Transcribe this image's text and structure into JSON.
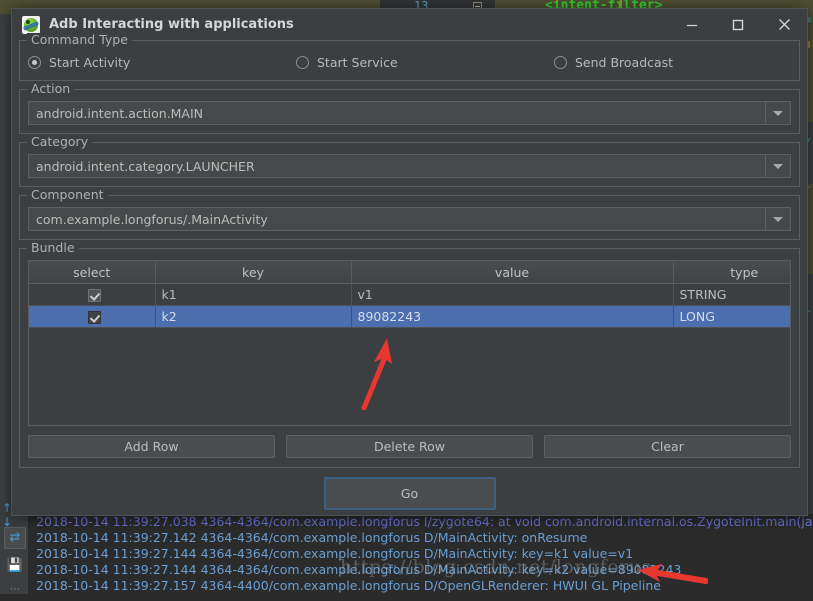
{
  "dialog": {
    "title": "Adb Interacting with applications",
    "icon": "android-adb-icon",
    "window_controls": {
      "minimize": "minimize-icon",
      "maximize": "maximize-icon",
      "close": "close-icon"
    },
    "command_type": {
      "legend": "Command Type",
      "options": [
        {
          "label": "Start Activity",
          "selected": true
        },
        {
          "label": "Start Service",
          "selected": false
        },
        {
          "label": "Send Broadcast",
          "selected": false
        }
      ]
    },
    "action": {
      "legend": "Action",
      "value": "android.intent.action.MAIN"
    },
    "category": {
      "legend": "Category",
      "value": "android.intent.category.LAUNCHER"
    },
    "component": {
      "legend": "Component",
      "value": "com.example.longforus/.MainActivity"
    },
    "bundle": {
      "legend": "Bundle",
      "columns": [
        "select",
        "key",
        "value",
        "type"
      ],
      "rows": [
        {
          "select": true,
          "key": "k1",
          "value": "v1",
          "type": "STRING",
          "selected": false
        },
        {
          "select": true,
          "key": "k2",
          "value": "89082243",
          "type": "LONG",
          "selected": true
        }
      ],
      "buttons": {
        "add": "Add Row",
        "delete": "Delete Row",
        "clear": "Clear"
      }
    },
    "go_button": "Go"
  },
  "ide_background": {
    "line_number": "13",
    "xml_snippet": "<intent-filter>"
  },
  "logcat": {
    "lines": [
      {
        "text": "2018-10-14 11:39:27.038 4364-4364/com.example.longforus I/zygote64:    at void com.android.internal.os.ZygoteInit.main(java.lang.S",
        "level": "info"
      },
      {
        "text": "2018-10-14 11:39:27.142 4364-4364/com.example.longforus D/MainActivity: onResume",
        "level": "debug"
      },
      {
        "text": "2018-10-14 11:39:27.144 4364-4364/com.example.longforus D/MainActivity: key=k1  value=v1",
        "level": "debug"
      },
      {
        "text": "2018-10-14 11:39:27.144 4364-4364/com.example.longforus D/MainActivity: key=k2  value=89082243",
        "level": "debug"
      },
      {
        "text": "2018-10-14 11:39:27.157 4364-4400/com.example.longforus D/OpenGLRenderer: HWUI GL Pipeline",
        "level": "debug"
      }
    ]
  },
  "watermark": "https://blog.csdn.net/longforus",
  "colors": {
    "dialog_bg": "#3c3f41",
    "selection_blue": "#4b6eaf",
    "focus_border": "#3d6185",
    "annotation_red": "#e8372f",
    "log_text": "#6a9fd4"
  }
}
